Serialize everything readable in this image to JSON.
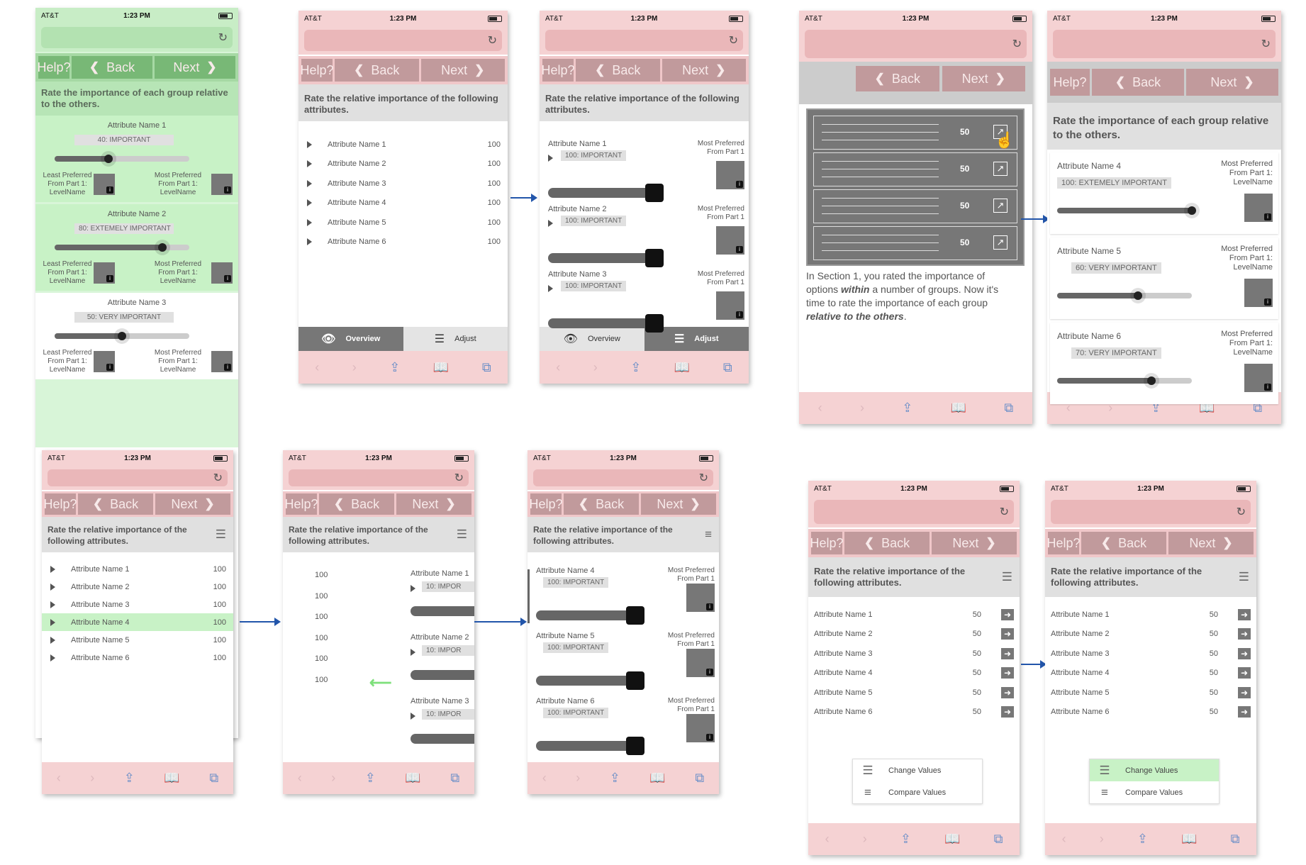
{
  "status": {
    "carrier": "AT&T",
    "time": "1:23 PM"
  },
  "nav": {
    "help": "Help?",
    "back": "Back",
    "next": "Next"
  },
  "tabs": {
    "overview": "Overview",
    "adjust": "Adjust"
  },
  "headers": {
    "rate_group": "Rate the importance of each group relative to the others.",
    "rate_relative": "Rate the relative importance of the following attributes."
  },
  "captions": {
    "least": "Least Preferred From Part 1: LevelName",
    "most": "Most Preferred From Part 1: LevelName",
    "most_short": "Most Preferred From Part 1"
  },
  "attributes": [
    "Attribute Name 1",
    "Attribute Name 2",
    "Attribute Name 3",
    "Attribute Name 4",
    "Attribute Name 5",
    "Attribute Name 6"
  ],
  "screen_group_sliders": [
    {
      "name": "Attribute Name 1",
      "level": "40: IMPORTANT",
      "value": 40
    },
    {
      "name": "Attribute Name 2",
      "level": "80: EXTEMELY IMPORTANT",
      "value": 80
    },
    {
      "name": "Attribute Name 3",
      "level": "50: VERY IMPORTANT",
      "value": 50
    }
  ],
  "overview_values": [
    "100",
    "100",
    "100",
    "100",
    "100",
    "100"
  ],
  "adjust_cards": [
    {
      "name": "Attribute Name 1",
      "level": "100: IMPORTANT"
    },
    {
      "name": "Attribute Name 2",
      "level": "100: IMPORTANT"
    },
    {
      "name": "Attribute Name 3",
      "level": "100: IMPORTANT"
    }
  ],
  "intro": {
    "p1": "In Section 1, you rated the importance of options ",
    "within": "within",
    "p2": " a number of groups. Now it's time to rate the importance of each group ",
    "relative": "relative to the others",
    "p3": "."
  },
  "illustration_values": [
    "50",
    "50",
    "50",
    "50"
  ],
  "group_cards_456": [
    {
      "name": "Attribute Name 4",
      "level": "100: EXTEMELY IMPORTANT",
      "value": 100
    },
    {
      "name": "Attribute Name 5",
      "level": "60: VERY IMPORTANT",
      "value": 60
    },
    {
      "name": "Attribute Name 6",
      "level": "70: VERY IMPORTANT",
      "value": 70
    }
  ],
  "transition_values": [
    "100",
    "100",
    "100",
    "100",
    "100",
    "100"
  ],
  "transition_cards": [
    {
      "name": "Attribute Name 1",
      "level": "10: IMPOR"
    },
    {
      "name": "Attribute Name 2",
      "level": "10: IMPOR"
    },
    {
      "name": "Attribute Name 3",
      "level": "10: IMPOR"
    }
  ],
  "adjust_cards_456": [
    {
      "name": "Attribute Name 4",
      "level": "100: IMPORTANT"
    },
    {
      "name": "Attribute Name 5",
      "level": "100: IMPORTANT"
    },
    {
      "name": "Attribute Name 6",
      "level": "100: IMPORTANT"
    }
  ],
  "rows50": [
    "50",
    "50",
    "50",
    "50",
    "50",
    "50"
  ],
  "menu": {
    "change": "Change Values",
    "compare": "Compare Values"
  },
  "colors": {
    "pink": "#f5d2d3",
    "green": "#c8edc6",
    "highlight": "#c8f2c6",
    "arrow": "#2255aa"
  }
}
